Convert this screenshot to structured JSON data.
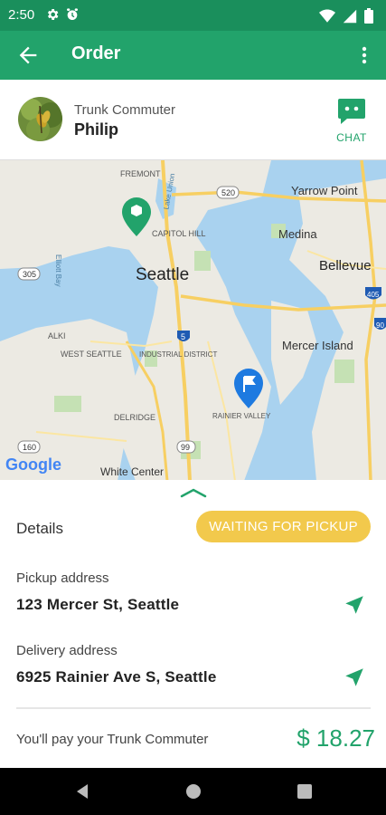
{
  "status_bar": {
    "time": "2:50",
    "icons": [
      "settings-gear-icon",
      "alarm-icon",
      "wifi-icon",
      "signal-icon",
      "battery-icon"
    ]
  },
  "app_bar": {
    "title": "Order",
    "back_icon": "arrow-back-icon",
    "menu_icon": "more-vert-icon"
  },
  "profile": {
    "role": "Trunk Commuter",
    "name": "Philip",
    "chat_label": "CHAT"
  },
  "map": {
    "labels": {
      "fremont": "FREMONT",
      "lake_union": "Lake Union",
      "capitol_hill": "CAPITOL HILL",
      "seattle": "Seattle",
      "yarrow_point": "Yarrow Point",
      "medina": "Medina",
      "bellevue": "Bellevue",
      "elliott_bay": "Elliott Bay",
      "alki": "ALKI",
      "west_seattle": "WEST SEATTLE",
      "industrial_district": "INDUSTRIAL DISTRICT",
      "mercer_island": "Mercer Island",
      "delridge": "DELRIDGE",
      "rainier_valley": "RAINIER VALLEY",
      "white_center": "White Center",
      "google": "Google"
    },
    "shields": {
      "h520": "520",
      "h305": "305",
      "h5": "5",
      "h405": "405",
      "h90": "90",
      "h160": "160",
      "h99": "99"
    },
    "pickup_marker_icon": "package-marker-icon",
    "delivery_marker_icon": "flag-marker-icon"
  },
  "details": {
    "heading": "Details",
    "status": "WAITING FOR PICKUP",
    "pickup_label": "Pickup address",
    "pickup_value": "123 Mercer St, Seattle",
    "delivery_label": "Delivery address",
    "delivery_value": "6925 Rainier Ave S, Seattle",
    "pay_label": "You'll pay your Trunk Commuter",
    "pay_amount": "$ 18.27"
  },
  "colors": {
    "primary": "#22a36b",
    "primary_dark": "#1a8f5c",
    "status_pill": "#f2c94c",
    "marker_blue": "#1e7ae0"
  }
}
